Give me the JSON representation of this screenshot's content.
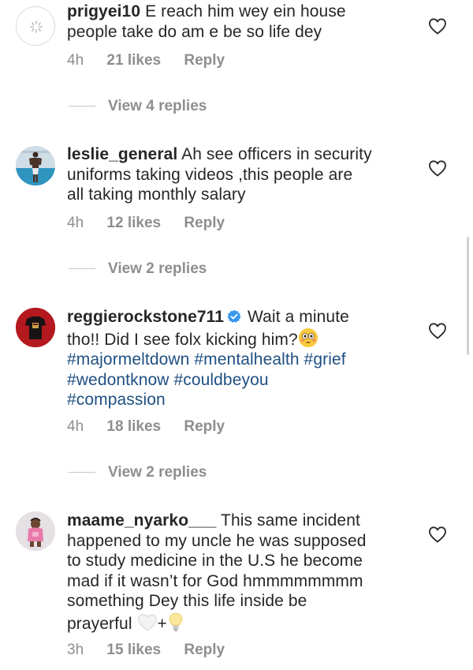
{
  "comments": [
    {
      "username": "prigyei10",
      "text_lines": [
        "E reach him wey ein house",
        "people take do am e be so life dey"
      ],
      "time": "4h",
      "likes": "21 likes",
      "reply": "Reply",
      "view_replies": "View 4 replies",
      "avatar": "loading-spinner-icon"
    },
    {
      "username": "leslie_general",
      "text_lines": [
        "Ah see officers in security",
        "uniforms taking videos ,this people are",
        "all taking monthly salary"
      ],
      "time": "4h",
      "likes": "12 likes",
      "reply": "Reply",
      "view_replies": "View 2 replies",
      "avatar": "profile-photo"
    },
    {
      "username": "reggierockstone711",
      "verified": true,
      "text_first": "Wait a minute",
      "text_second": "tho!! Did I see folx kicking him?",
      "hashtags_line1": "#majormeltdown #mentalhealth #grief",
      "hashtags_line2": "#wedontknow #couldbeyou",
      "hashtags_line3": "#compassion",
      "time": "4h",
      "likes": "18 likes",
      "reply": "Reply",
      "view_replies": "View 2 replies",
      "avatar": "profile-photo"
    },
    {
      "username": "maame_nyarko___",
      "text_lines": [
        "This same incident",
        "happened to my uncle he was supposed",
        "to study medicine in the U.S he become",
        "mad if it wasn’t for God hmmmmmmmm",
        "something Dey this life inside be",
        "prayerful"
      ],
      "plus": "+",
      "time": "3h",
      "likes": "15 likes",
      "reply": "Reply",
      "avatar": "profile-photo"
    }
  ],
  "colors": {
    "text": "#262626",
    "meta": "#8e8e8e",
    "hashtag": "#1f4f82",
    "verified": "#3897f0"
  }
}
